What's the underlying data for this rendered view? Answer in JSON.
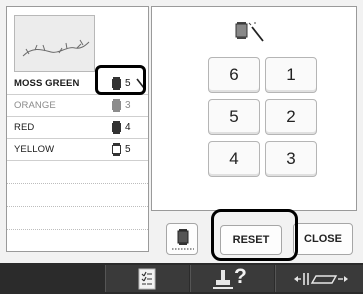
{
  "thread_list": {
    "items": [
      {
        "name": "MOSS GREEN",
        "order": "5",
        "state": "selected"
      },
      {
        "name": "ORANGE",
        "order": "3",
        "state": "dim"
      },
      {
        "name": "RED",
        "order": "4",
        "state": "normal"
      },
      {
        "name": "YELLOW",
        "order": "5",
        "state": "normal"
      }
    ]
  },
  "keypad": {
    "keys": [
      "6",
      "1",
      "5",
      "2",
      "4",
      "3"
    ]
  },
  "actions": {
    "reset_label": "RESET",
    "close_label": "CLOSE"
  },
  "status_bar": {
    "help_label": "?"
  },
  "colors": {
    "panel_bg": "#ffffff",
    "screen_bg": "#f2f2f2",
    "status_bar_bg": "#2b2b2b",
    "highlight": "#000000"
  },
  "icons": {
    "thread_spool": "spool-icon",
    "magic_wand": "magic-wand-icon",
    "thread_cut": "thread-spool-button-icon",
    "checklist": "checklist-icon",
    "presser_foot": "presser-foot-icon",
    "frame_move": "frame-move-icon"
  }
}
